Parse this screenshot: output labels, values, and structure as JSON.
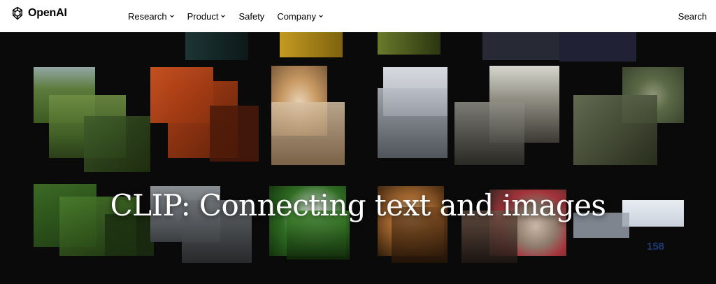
{
  "brand": {
    "name": "OpenAI"
  },
  "nav": {
    "items": [
      {
        "label": "Research",
        "has_dropdown": true
      },
      {
        "label": "Product",
        "has_dropdown": true
      },
      {
        "label": "Safety",
        "has_dropdown": false
      },
      {
        "label": "Company",
        "has_dropdown": true
      }
    ],
    "search_label": "Search"
  },
  "hero": {
    "headline": "CLIP: Connecting text and images",
    "number_card_text": "158"
  },
  "colors": {
    "navbar_bg": "#ffffff",
    "hero_bg": "#0a0a0a",
    "text_on_hero": "#ffffff"
  }
}
